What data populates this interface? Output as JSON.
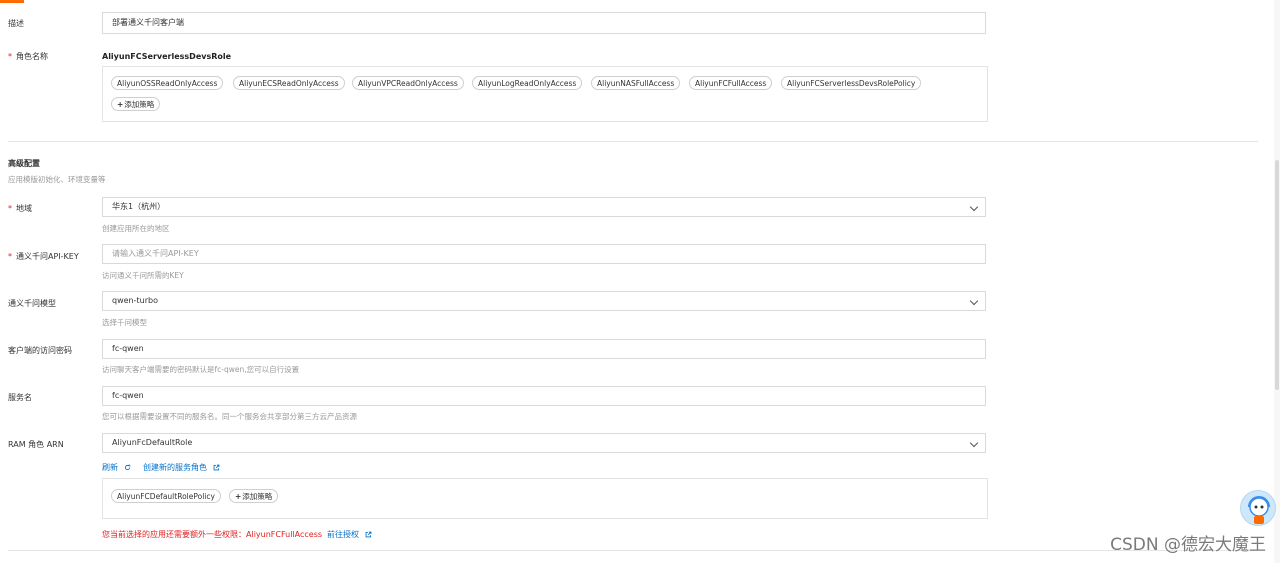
{
  "fields": {
    "description": {
      "label": "描述",
      "value": "部署通义千问客户端"
    },
    "role_name": {
      "label": "角色名称",
      "value": "AliyunFCServerlessDevsRole",
      "policies": [
        "AliyunOSSReadOnlyAccess",
        "AliyunECSReadOnlyAccess",
        "AliyunVPCReadOnlyAccess",
        "AliyunLogReadOnlyAccess",
        "AliyunNASFullAccess",
        "AliyunFCFullAccess",
        "AliyunFCServerlessDevsRolePolicy"
      ],
      "add_policy": "添加策略"
    }
  },
  "advanced": {
    "title": "高级配置",
    "subtitle": "应用模版初始化、环境变量等",
    "region": {
      "label": "地域",
      "value": "华东1（杭州）",
      "hint": "创建应用所在的地区"
    },
    "api_key": {
      "label": "通义千问API-KEY",
      "placeholder": "请输入通义千问API-KEY",
      "hint": "访问通义千问所需的KEY"
    },
    "model": {
      "label": "通义千问模型",
      "value": "qwen-turbo",
      "hint": "选择千问模型"
    },
    "client_password": {
      "label": "客户端的访问密码",
      "value": "fc-qwen",
      "hint": "访问聊天客户端需要的密码默认是fc-qwen,您可以自行设置"
    },
    "service_name": {
      "label": "服务名",
      "value": "fc-qwen",
      "hint": "您可以根据需要设置不同的服务名。同一个服务会共享部分第三方云产品资源"
    },
    "ram_role": {
      "label": "RAM 角色 ARN",
      "value": "AliyunFcDefaultRole",
      "refresh": "刷新",
      "create_role": "创建新的服务角色",
      "policies": [
        "AliyunFCDefaultRolePolicy"
      ],
      "add_policy": "添加策略"
    },
    "warning": {
      "text": "您当前选择的应用还需要额外一些权限：AliyunFCFullAccess",
      "link": "前往授权"
    }
  },
  "watermark": "CSDN @德宏大魔王",
  "colors": {
    "accent": "#ff6a00",
    "link": "#0070cc",
    "required": "#e02020"
  }
}
